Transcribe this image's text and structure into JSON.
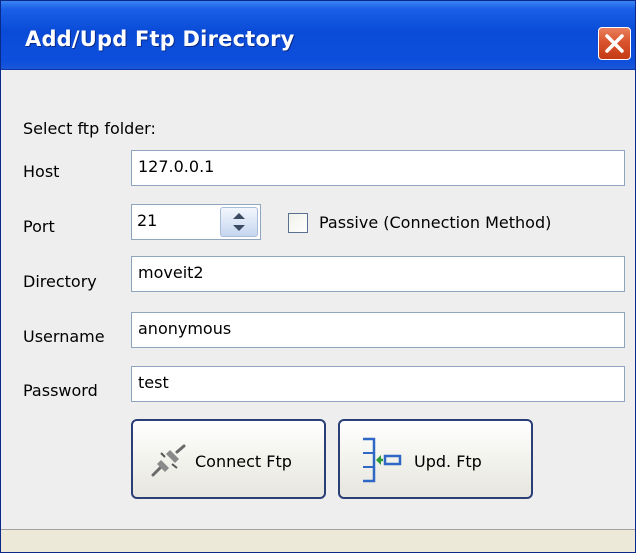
{
  "window": {
    "title": "Add/Upd Ftp Directory",
    "close_icon": "close-icon",
    "titlebar_color": "#0a4cd8",
    "close_color": "#d9532c"
  },
  "form": {
    "select_label": "Select ftp folder:",
    "host": {
      "label": "Host",
      "value": "127.0.0.1"
    },
    "port": {
      "label": "Port",
      "value": "21",
      "spinner_icon": "spinner-arrows-icon"
    },
    "passive": {
      "label": "Passive (Connection Method)",
      "checked": false
    },
    "directory": {
      "label": "Directory",
      "value": "moveit2"
    },
    "username": {
      "label": "Username",
      "value": "anonymous"
    },
    "password": {
      "label": "Password",
      "value": "test"
    }
  },
  "buttons": {
    "connect": {
      "label": "Connect Ftp",
      "icon": "disconnected-plug-icon"
    },
    "update": {
      "label": "Upd. Ftp",
      "icon": "update-folder-icon"
    }
  },
  "colors": {
    "border_accent": "#2b3f77",
    "field_border": "#8fa5bd",
    "icon_blue": "#2f67c6",
    "icon_green": "#2b9a3a"
  }
}
